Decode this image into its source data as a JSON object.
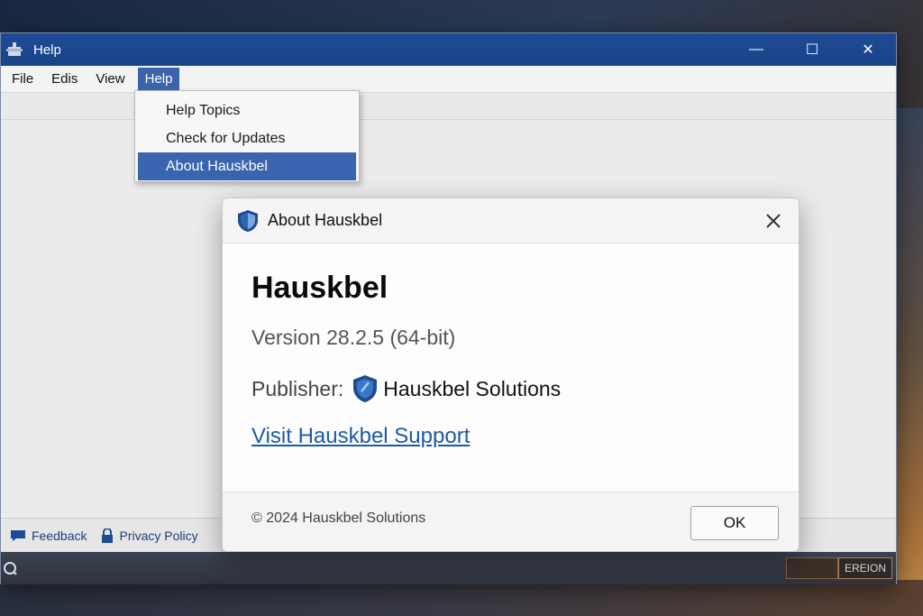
{
  "window": {
    "title": "Help",
    "minimize_glyph": "—",
    "maximize_glyph": "☐",
    "close_glyph": "✕"
  },
  "menubar": {
    "items": [
      "File",
      "Edis",
      "View",
      "Help"
    ],
    "active": "Help"
  },
  "help_menu": {
    "items": [
      "Help Topics",
      "Check for Updates",
      "About Hauskbel"
    ],
    "selected": "About Hauskbel"
  },
  "statusbar": {
    "feedback": "Feedback",
    "privacy": "Privacy Policy"
  },
  "badge": {
    "label": "EREION"
  },
  "about_dialog": {
    "title": "About Hauskbel",
    "app_name": "Hauskbel",
    "version": "Version 28.2.5 (64-bit)",
    "publisher_label": "Publisher:",
    "publisher_name": "Hauskbel Solutions",
    "support_link": "Visit Hauskbel Support",
    "copyright": "© 2024 Hauskbel Solutions",
    "ok_label": "OK"
  },
  "colors": {
    "titlebar": "#1d4b94",
    "menu_highlight": "#3a64ad",
    "link": "#1b5aa8"
  }
}
